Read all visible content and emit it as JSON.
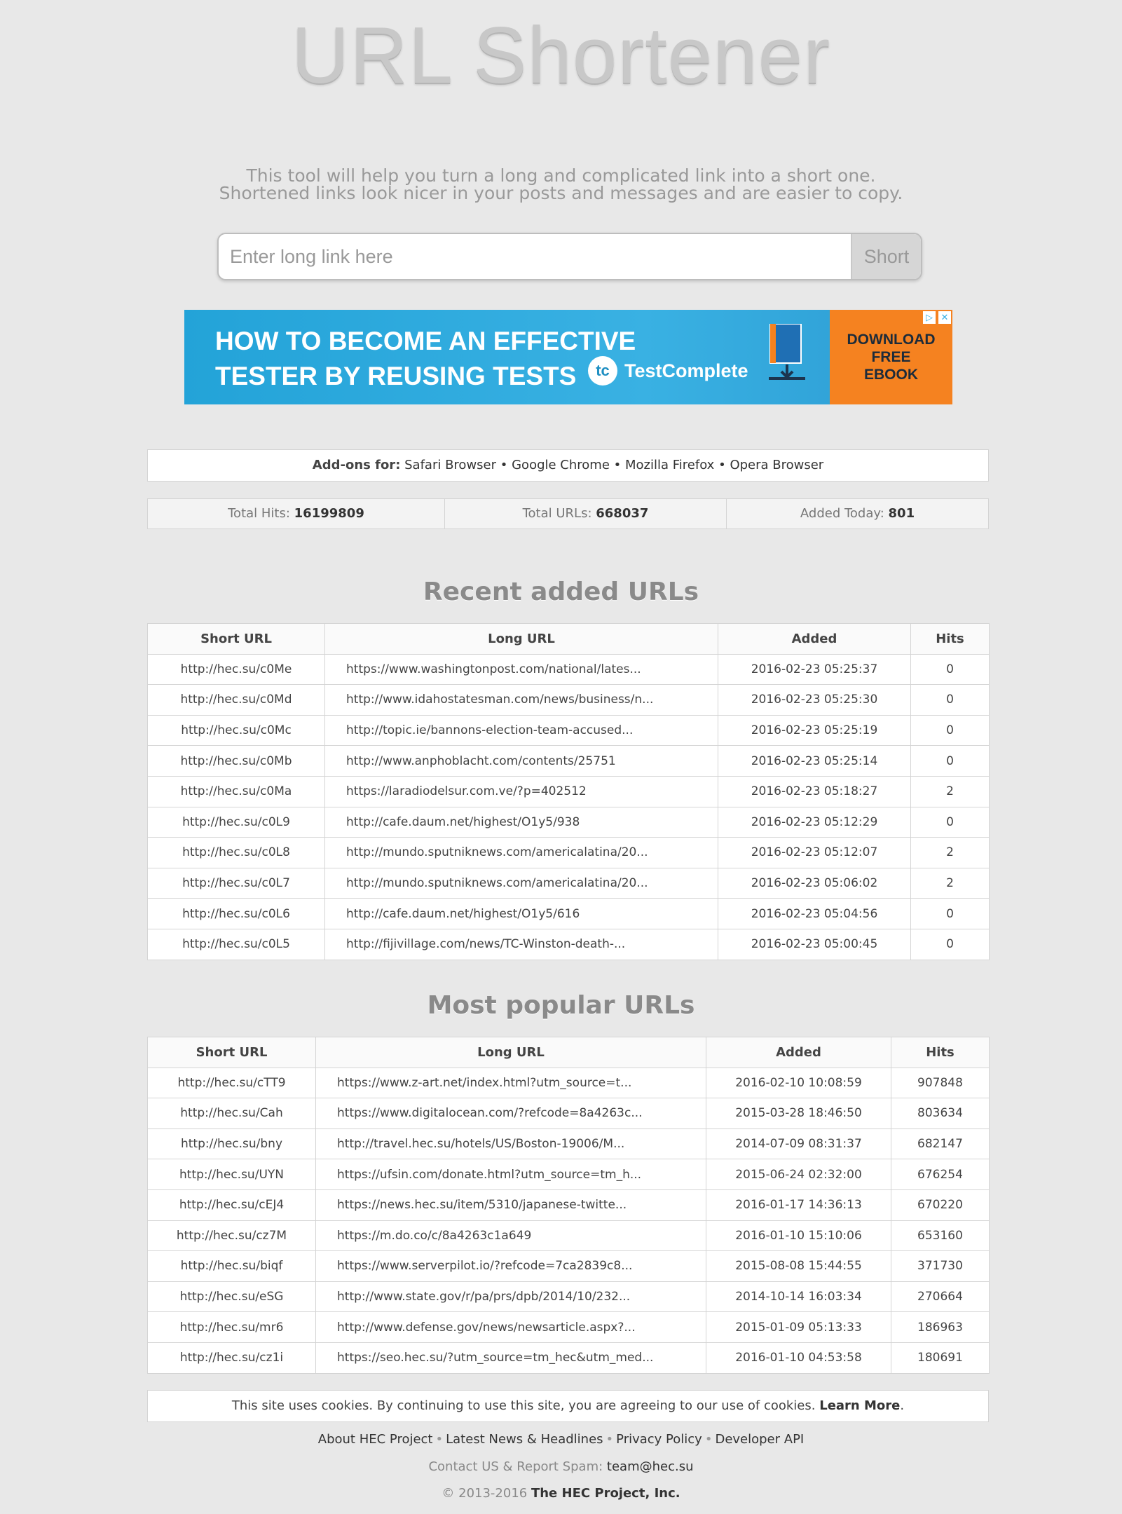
{
  "logo": "URL Shortener",
  "description": {
    "line1": "This tool will help you turn a long and complicated link into a short one.",
    "line2": "Shortened links look nicer in your posts and messages and are easier to copy."
  },
  "form": {
    "placeholder": "Enter long link here",
    "button": "Short"
  },
  "ad": {
    "line1": "HOW TO BECOME AN EFFECTIVE",
    "line2": "TESTER BY REUSING TESTS",
    "brand": "TestComplete",
    "brand_icon": "tc",
    "cta1": "DOWNLOAD",
    "cta2": "FREE",
    "cta3": "EBOOK",
    "adchoices": "▷",
    "close": "✕"
  },
  "addons": {
    "label": "Add-ons for:",
    "items": [
      "Safari Browser",
      "Google Chrome",
      "Mozilla Firefox",
      "Opera Browser"
    ]
  },
  "stats": {
    "hits_label": "Total Hits:",
    "hits": "16199809",
    "urls_label": "Total URLs:",
    "urls": "668037",
    "today_label": "Added Today:",
    "today": "801"
  },
  "recent": {
    "title": "Recent added URLs",
    "headers": [
      "Short URL",
      "Long URL",
      "Added",
      "Hits"
    ],
    "rows": [
      [
        "http://hec.su/c0Me",
        "https://www.washingtonpost.com/national/lates...",
        "2016-02-23 05:25:37",
        "0"
      ],
      [
        "http://hec.su/c0Md",
        "http://www.idahostatesman.com/news/business/n...",
        "2016-02-23 05:25:30",
        "0"
      ],
      [
        "http://hec.su/c0Mc",
        "http://topic.ie/bannons-election-team-accused...",
        "2016-02-23 05:25:19",
        "0"
      ],
      [
        "http://hec.su/c0Mb",
        "http://www.anphoblacht.com/contents/25751",
        "2016-02-23 05:25:14",
        "0"
      ],
      [
        "http://hec.su/c0Ma",
        "https://laradiodelsur.com.ve/?p=402512",
        "2016-02-23 05:18:27",
        "2"
      ],
      [
        "http://hec.su/c0L9",
        "http://cafe.daum.net/highest/O1y5/938",
        "2016-02-23 05:12:29",
        "0"
      ],
      [
        "http://hec.su/c0L8",
        "http://mundo.sputniknews.com/americalatina/20...",
        "2016-02-23 05:12:07",
        "2"
      ],
      [
        "http://hec.su/c0L7",
        "http://mundo.sputniknews.com/americalatina/20...",
        "2016-02-23 05:06:02",
        "2"
      ],
      [
        "http://hec.su/c0L6",
        "http://cafe.daum.net/highest/O1y5/616",
        "2016-02-23 05:04:56",
        "0"
      ],
      [
        "http://hec.su/c0L5",
        "http://fijivillage.com/news/TC-Winston-death-...",
        "2016-02-23 05:00:45",
        "0"
      ]
    ]
  },
  "popular": {
    "title": "Most popular URLs",
    "headers": [
      "Short URL",
      "Long URL",
      "Added",
      "Hits"
    ],
    "rows": [
      [
        "http://hec.su/cTT9",
        "https://www.z-art.net/index.html?utm_source=t...",
        "2016-02-10 10:08:59",
        "907848"
      ],
      [
        "http://hec.su/Cah",
        "https://www.digitalocean.com/?refcode=8a4263c...",
        "2015-03-28 18:46:50",
        "803634"
      ],
      [
        "http://hec.su/bny",
        "http://travel.hec.su/hotels/US/Boston-19006/M...",
        "2014-07-09 08:31:37",
        "682147"
      ],
      [
        "http://hec.su/UYN",
        "https://ufsin.com/donate.html?utm_source=tm_h...",
        "2015-06-24 02:32:00",
        "676254"
      ],
      [
        "http://hec.su/cEJ4",
        "https://news.hec.su/item/5310/japanese-twitte...",
        "2016-01-17 14:36:13",
        "670220"
      ],
      [
        "http://hec.su/cz7M",
        "https://m.do.co/c/8a4263c1a649",
        "2016-01-10 15:10:06",
        "653160"
      ],
      [
        "http://hec.su/biqf",
        "https://www.serverpilot.io/?refcode=7ca2839c8...",
        "2015-08-08 15:44:55",
        "371730"
      ],
      [
        "http://hec.su/eSG",
        "http://www.state.gov/r/pa/prs/dpb/2014/10/232...",
        "2014-10-14 16:03:34",
        "270664"
      ],
      [
        "http://hec.su/mr6",
        "http://www.defense.gov/news/newsarticle.aspx?...",
        "2015-01-09 05:13:33",
        "186963"
      ],
      [
        "http://hec.su/cz1i",
        "https://seo.hec.su/?utm_source=tm_hec&utm_med...",
        "2016-01-10 04:53:58",
        "180691"
      ]
    ]
  },
  "cookie": {
    "text": "This site uses cookies. By continuing to use this site, you are agreeing to our use of cookies.",
    "link": "Learn More",
    "end": "."
  },
  "footer": {
    "links": [
      "About HEC Project",
      "Latest News & Headlines",
      "Privacy Policy",
      "Developer API"
    ],
    "contact_label": "Contact US & Report Spam:",
    "email": "team@hec.su",
    "copyright": "© 2013-2016",
    "company": "The HEC Project, Inc."
  }
}
